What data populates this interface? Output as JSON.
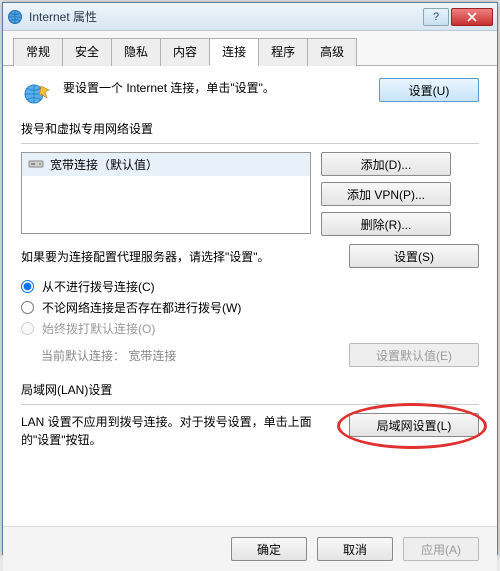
{
  "window": {
    "title": "Internet 属性"
  },
  "tabs": [
    "常规",
    "安全",
    "隐私",
    "内容",
    "连接",
    "程序",
    "高级"
  ],
  "active_tab": 4,
  "conn_setup": {
    "text": "要设置一个 Internet 连接，单击\"设置\"。",
    "button": "设置(U)"
  },
  "dial_group": {
    "label": "拨号和虚拟专用网络设置",
    "list": [
      {
        "name": "宽带连接（默认值）",
        "selected": true
      }
    ],
    "buttons": {
      "add": "添加(D)...",
      "add_vpn": "添加 VPN(P)...",
      "remove": "删除(R)..."
    },
    "proxy_text": "如果要为连接配置代理服务器，请选择\"设置\"。",
    "proxy_button": "设置(S)",
    "radios": {
      "never": "从不进行拨号连接(C)",
      "whenever": "不论网络连接是否存在都进行拨号(W)",
      "always_default": "始终拨打默认连接(O)"
    },
    "selected_radio": "never",
    "default_label": "当前默认连接：",
    "default_value": "宽带连接",
    "set_default_btn": "设置默认值(E)"
  },
  "lan_group": {
    "label": "局域网(LAN)设置",
    "text": "LAN 设置不应用到拨号连接。对于拨号设置，单击上面的\"设置\"按钮。",
    "button": "局域网设置(L)"
  },
  "footer": {
    "ok": "确定",
    "cancel": "取消",
    "apply": "应用(A)"
  }
}
